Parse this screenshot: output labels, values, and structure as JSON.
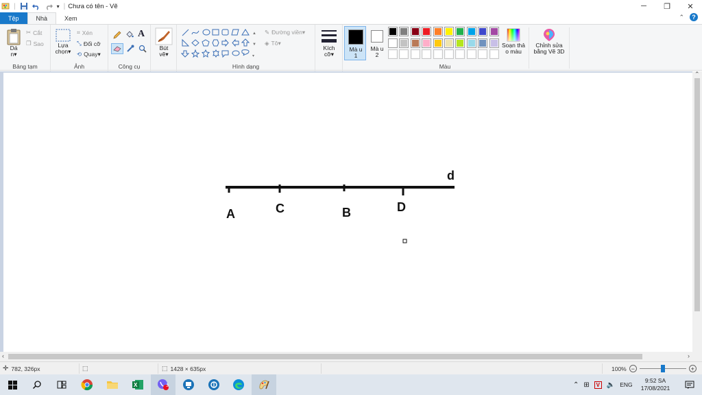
{
  "window": {
    "title": "Chưa có tên - Vẽ"
  },
  "tabs": [
    {
      "label": "Tệp"
    },
    {
      "label": "Nhà"
    },
    {
      "label": "Xem"
    }
  ],
  "ribbon": {
    "clipboard": {
      "paste_label": "Dá n▾",
      "cut_label": "Cắt",
      "copy_label": "Sao",
      "group_label": "Bảng tạm"
    },
    "image": {
      "select_label": "Lựa chọn▾",
      "crop_label": "Xén",
      "resize_label": "Đổi cỡ",
      "rotate_label": "Quay▾",
      "group_label": "Ảnh"
    },
    "tools": {
      "group_label": "Công cụ"
    },
    "brushes": {
      "label": "Bút vẽ▾"
    },
    "shapes": {
      "outline_label": "Đường viền▾",
      "fill_label": "Tô▾",
      "group_label": "Hình dạng"
    },
    "size": {
      "label": "Kích cỡ▾"
    },
    "color1": {
      "label": "Mà u 1",
      "value": "#000000"
    },
    "color2": {
      "label": "Mà u 2",
      "value": "#ffffff"
    },
    "colors": {
      "group_label": "Màu",
      "row1": [
        "#000000",
        "#7f7f7f",
        "#880015",
        "#ed1c24",
        "#ff7f27",
        "#fff200",
        "#22b14c",
        "#00a2e8",
        "#3f48cc",
        "#a349a4"
      ],
      "row2": [
        "#ffffff",
        "#c3c3c3",
        "#b97a57",
        "#ffaec9",
        "#ffc90e",
        "#efe4b0",
        "#b5e61d",
        "#99d9ea",
        "#7092be",
        "#c8bfe7"
      ],
      "row3": [
        "#ffffff",
        "#ffffff",
        "#ffffff",
        "#ffffff",
        "#ffffff",
        "#ffffff",
        "#ffffff",
        "#ffffff",
        "#ffffff",
        "#ffffff"
      ]
    },
    "edit_colors": {
      "label": "Soạn thả o màu"
    },
    "paint3d": {
      "label": "Chỉnh sửa bằng Vẽ 3D"
    }
  },
  "canvas": {
    "labels": {
      "A": "A",
      "C": "C",
      "B": "B",
      "D": "D",
      "d": "d"
    }
  },
  "statusbar": {
    "cursor_pos": "782, 326px",
    "image_size": "1428 × 635px",
    "zoom": "100%"
  },
  "taskbar": {
    "icons": [
      "windows-start",
      "search",
      "task-view",
      "chrome",
      "file-explorer",
      "excel",
      "viber",
      "app-1",
      "app-2",
      "edge",
      "paint"
    ],
    "badge_count": "3",
    "language": "ENG",
    "time": "9:52 SA",
    "date": "17/08/2021"
  }
}
